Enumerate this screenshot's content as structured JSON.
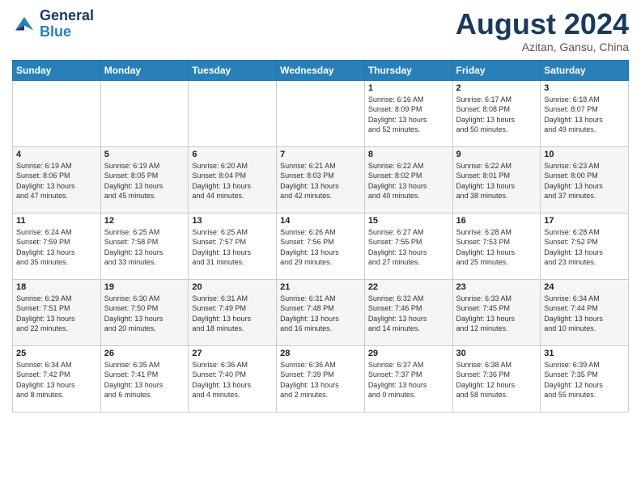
{
  "logo": {
    "line1": "General",
    "line2": "Blue"
  },
  "title": "August 2024",
  "subtitle": "Azitan, Gansu, China",
  "weekdays": [
    "Sunday",
    "Monday",
    "Tuesday",
    "Wednesday",
    "Thursday",
    "Friday",
    "Saturday"
  ],
  "weeks": [
    [
      {
        "day": "",
        "info": ""
      },
      {
        "day": "",
        "info": ""
      },
      {
        "day": "",
        "info": ""
      },
      {
        "day": "",
        "info": ""
      },
      {
        "day": "1",
        "info": "Sunrise: 6:16 AM\nSunset: 8:09 PM\nDaylight: 13 hours\nand 52 minutes."
      },
      {
        "day": "2",
        "info": "Sunrise: 6:17 AM\nSunset: 8:08 PM\nDaylight: 13 hours\nand 50 minutes."
      },
      {
        "day": "3",
        "info": "Sunrise: 6:18 AM\nSunset: 8:07 PM\nDaylight: 13 hours\nand 49 minutes."
      }
    ],
    [
      {
        "day": "4",
        "info": "Sunrise: 6:19 AM\nSunset: 8:06 PM\nDaylight: 13 hours\nand 47 minutes."
      },
      {
        "day": "5",
        "info": "Sunrise: 6:19 AM\nSunset: 8:05 PM\nDaylight: 13 hours\nand 45 minutes."
      },
      {
        "day": "6",
        "info": "Sunrise: 6:20 AM\nSunset: 8:04 PM\nDaylight: 13 hours\nand 44 minutes."
      },
      {
        "day": "7",
        "info": "Sunrise: 6:21 AM\nSunset: 8:03 PM\nDaylight: 13 hours\nand 42 minutes."
      },
      {
        "day": "8",
        "info": "Sunrise: 6:22 AM\nSunset: 8:02 PM\nDaylight: 13 hours\nand 40 minutes."
      },
      {
        "day": "9",
        "info": "Sunrise: 6:22 AM\nSunset: 8:01 PM\nDaylight: 13 hours\nand 38 minutes."
      },
      {
        "day": "10",
        "info": "Sunrise: 6:23 AM\nSunset: 8:00 PM\nDaylight: 13 hours\nand 37 minutes."
      }
    ],
    [
      {
        "day": "11",
        "info": "Sunrise: 6:24 AM\nSunset: 7:59 PM\nDaylight: 13 hours\nand 35 minutes."
      },
      {
        "day": "12",
        "info": "Sunrise: 6:25 AM\nSunset: 7:58 PM\nDaylight: 13 hours\nand 33 minutes."
      },
      {
        "day": "13",
        "info": "Sunrise: 6:25 AM\nSunset: 7:57 PM\nDaylight: 13 hours\nand 31 minutes."
      },
      {
        "day": "14",
        "info": "Sunrise: 6:26 AM\nSunset: 7:56 PM\nDaylight: 13 hours\nand 29 minutes."
      },
      {
        "day": "15",
        "info": "Sunrise: 6:27 AM\nSunset: 7:55 PM\nDaylight: 13 hours\nand 27 minutes."
      },
      {
        "day": "16",
        "info": "Sunrise: 6:28 AM\nSunset: 7:53 PM\nDaylight: 13 hours\nand 25 minutes."
      },
      {
        "day": "17",
        "info": "Sunrise: 6:28 AM\nSunset: 7:52 PM\nDaylight: 13 hours\nand 23 minutes."
      }
    ],
    [
      {
        "day": "18",
        "info": "Sunrise: 6:29 AM\nSunset: 7:51 PM\nDaylight: 13 hours\nand 22 minutes."
      },
      {
        "day": "19",
        "info": "Sunrise: 6:30 AM\nSunset: 7:50 PM\nDaylight: 13 hours\nand 20 minutes."
      },
      {
        "day": "20",
        "info": "Sunrise: 6:31 AM\nSunset: 7:49 PM\nDaylight: 13 hours\nand 18 minutes."
      },
      {
        "day": "21",
        "info": "Sunrise: 6:31 AM\nSunset: 7:48 PM\nDaylight: 13 hours\nand 16 minutes."
      },
      {
        "day": "22",
        "info": "Sunrise: 6:32 AM\nSunset: 7:46 PM\nDaylight: 13 hours\nand 14 minutes."
      },
      {
        "day": "23",
        "info": "Sunrise: 6:33 AM\nSunset: 7:45 PM\nDaylight: 13 hours\nand 12 minutes."
      },
      {
        "day": "24",
        "info": "Sunrise: 6:34 AM\nSunset: 7:44 PM\nDaylight: 13 hours\nand 10 minutes."
      }
    ],
    [
      {
        "day": "25",
        "info": "Sunrise: 6:34 AM\nSunset: 7:42 PM\nDaylight: 13 hours\nand 8 minutes."
      },
      {
        "day": "26",
        "info": "Sunrise: 6:35 AM\nSunset: 7:41 PM\nDaylight: 13 hours\nand 6 minutes."
      },
      {
        "day": "27",
        "info": "Sunrise: 6:36 AM\nSunset: 7:40 PM\nDaylight: 13 hours\nand 4 minutes."
      },
      {
        "day": "28",
        "info": "Sunrise: 6:36 AM\nSunset: 7:39 PM\nDaylight: 13 hours\nand 2 minutes."
      },
      {
        "day": "29",
        "info": "Sunrise: 6:37 AM\nSunset: 7:37 PM\nDaylight: 13 hours\nand 0 minutes."
      },
      {
        "day": "30",
        "info": "Sunrise: 6:38 AM\nSunset: 7:36 PM\nDaylight: 12 hours\nand 58 minutes."
      },
      {
        "day": "31",
        "info": "Sunrise: 6:39 AM\nSunset: 7:35 PM\nDaylight: 12 hours\nand 55 minutes."
      }
    ]
  ]
}
